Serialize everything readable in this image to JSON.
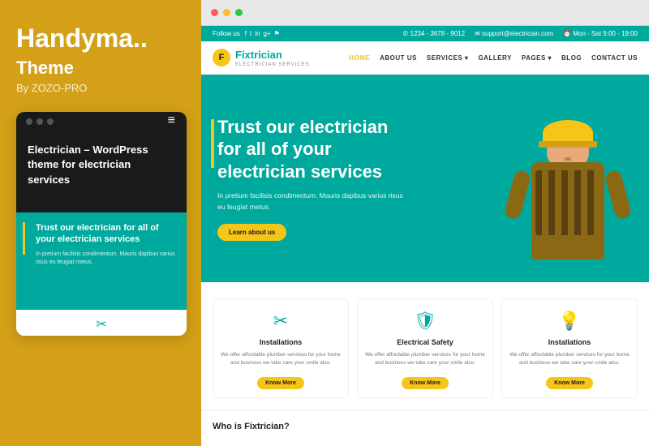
{
  "left": {
    "title": "Handyma..",
    "subtitle": "Theme",
    "author": "By ZOZO-PRO",
    "mobile_card": {
      "content_heading": "Electrician – WordPress theme for electrician services",
      "hero_title": "Trust our electrician for all of your electrician services",
      "hero_sub": "In pretium facilisis condimentum. Mauris dapibus varius risus eu feugiat metus."
    }
  },
  "browser": {
    "topbar": {
      "follow_us": "Follow us",
      "phone": "✆  1234 - 3678 - 9012",
      "email": "✉  support@electrician.com",
      "hours": "⏰  Mon - Sat 9:00 - 19:00"
    },
    "nav": {
      "logo_main": "Fixtrician",
      "logo_sub": "ELECTRICIAN SERVICES",
      "links": [
        "HOME",
        "ABOUT US",
        "SERVICES ▾",
        "GALLERY",
        "PAGES ▾",
        "BLOG",
        "CONTACT US"
      ]
    },
    "hero": {
      "title": "Trust our electrician\nfor all of your\nelectrician services",
      "desc": "In pretium facilisis condimentum. Mauris dapibus varius risus eu feugiat metus.",
      "cta": "Learn about us"
    },
    "services": [
      {
        "icon": "⚙",
        "title": "Installations",
        "desc": "We offer affordable plumber services for your home and business we take care your smile also.",
        "btn": "Know More"
      },
      {
        "icon": "🛡",
        "title": "Electrical Safety",
        "desc": "We offer affordable plumber services for your home and business we take care your smile also.",
        "btn": "Know More"
      },
      {
        "icon": "💡",
        "title": "Installations",
        "desc": "We offer affordable plumber services for your home and business we take care your smile also.",
        "btn": "Know More"
      }
    ],
    "who_title": "Who is Fixtrician?"
  },
  "colors": {
    "teal": "#00A99D",
    "yellow": "#F5C518",
    "dark": "#1a1a1a",
    "white": "#ffffff"
  }
}
